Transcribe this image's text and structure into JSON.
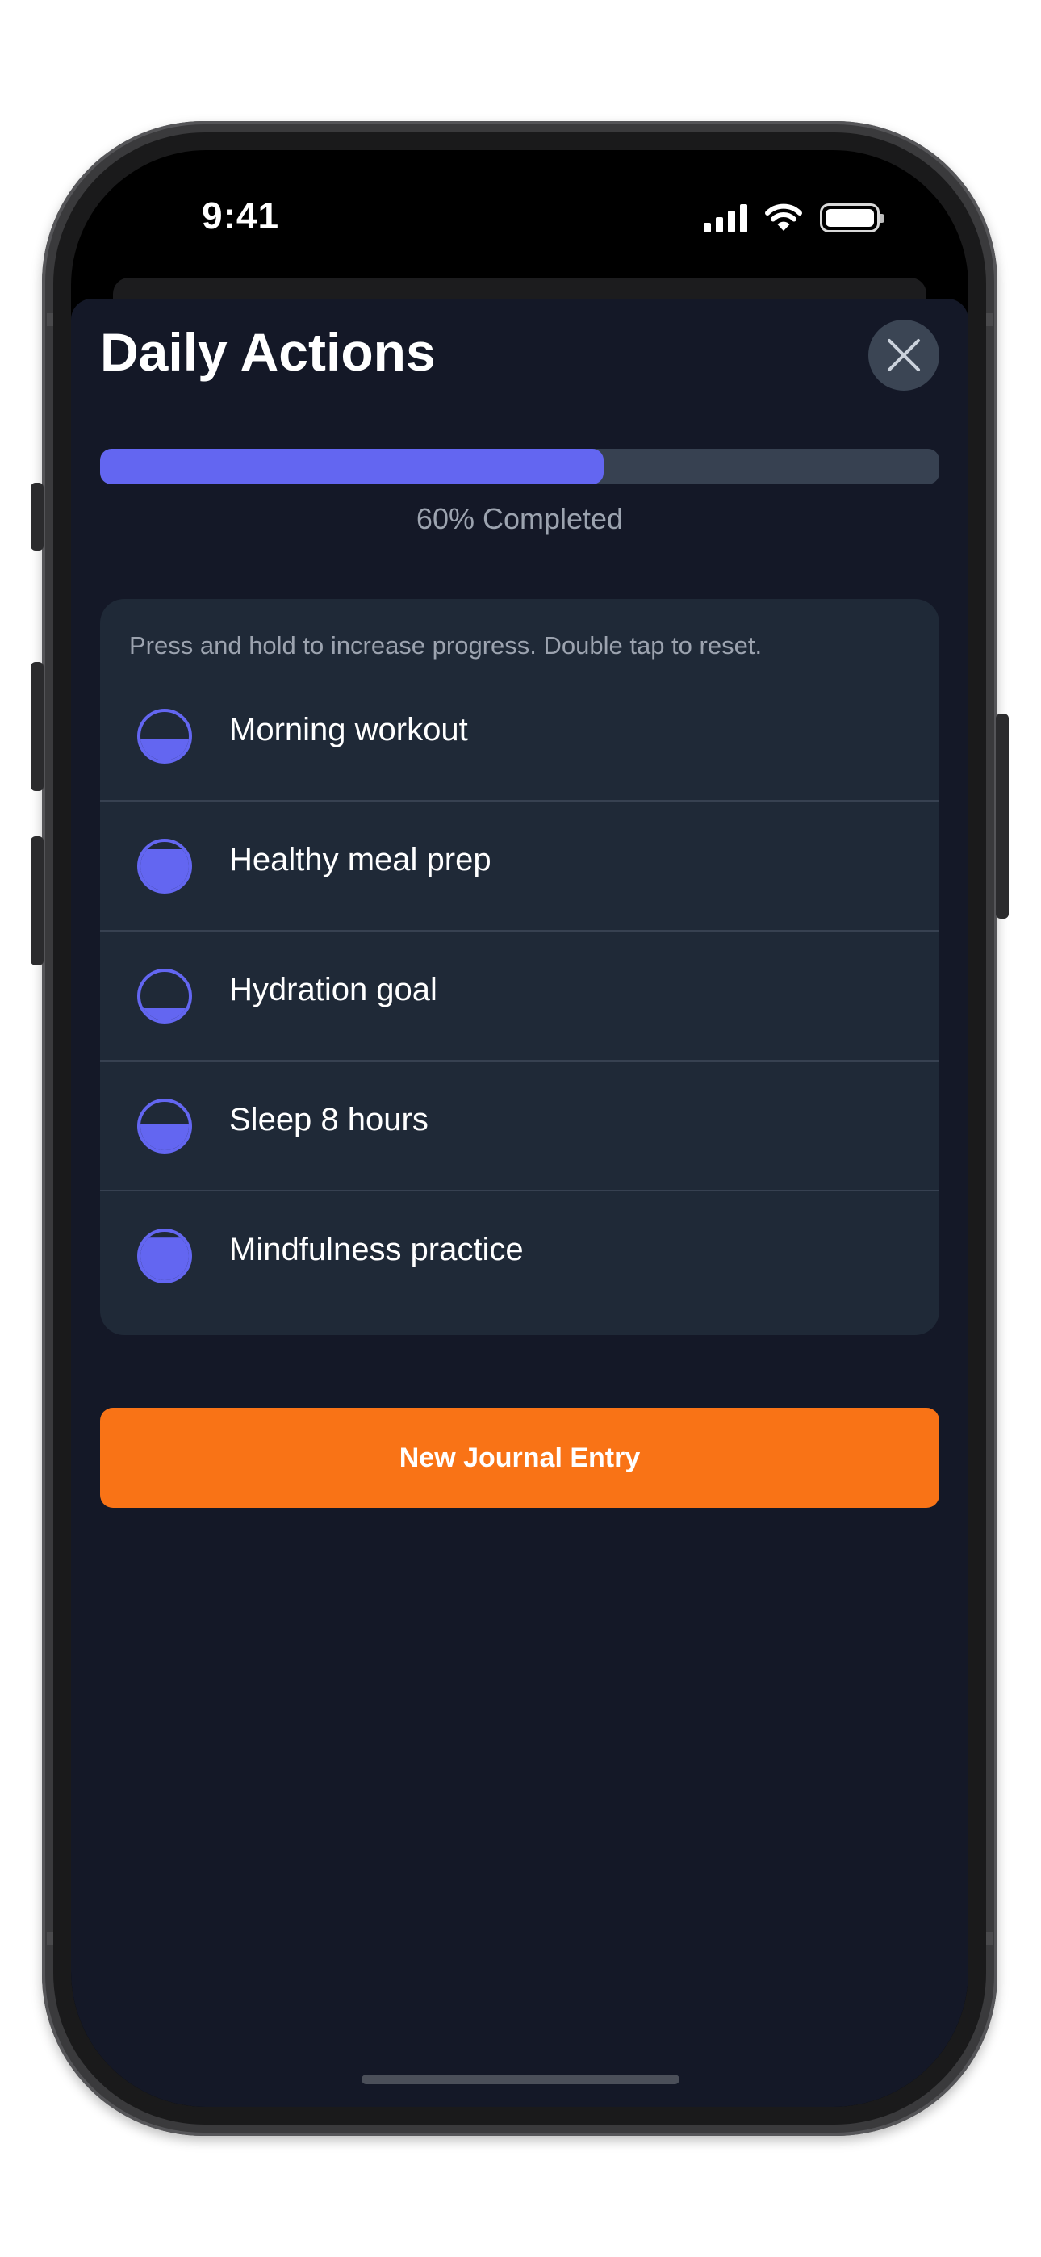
{
  "status_bar": {
    "time": "9:41"
  },
  "sheet": {
    "title": "Daily Actions",
    "close_icon": "close-icon"
  },
  "progress": {
    "value_fraction": 0.6,
    "label": "60% Completed"
  },
  "actions": {
    "hint": "Press and hold to increase progress. Double tap to reset.",
    "items": [
      {
        "label": "Morning workout",
        "fill_fraction": 0.45
      },
      {
        "label": "Healthy meal prep",
        "fill_fraction": 0.85
      },
      {
        "label": "Hydration goal",
        "fill_fraction": 0.25
      },
      {
        "label": "Sleep 8 hours",
        "fill_fraction": 0.55
      },
      {
        "label": "Mindfulness practice",
        "fill_fraction": 0.88
      }
    ]
  },
  "journal_button": {
    "label": "New Journal Entry"
  },
  "colors": {
    "background": "#141827",
    "card": "#1f2937",
    "accent": "#6366f1",
    "button": "#f97316",
    "muted_text": "#9ca3af"
  }
}
